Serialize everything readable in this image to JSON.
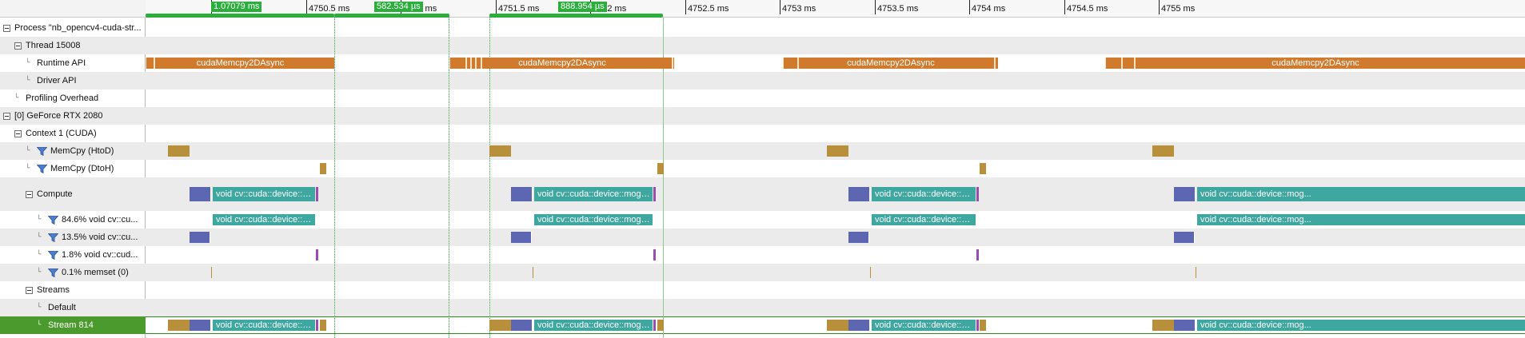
{
  "tree": {
    "rows": [
      {
        "label": "Process \"nb_opencv4-cuda-str...",
        "indent": 0,
        "toggle": true
      },
      {
        "label": "Thread 15008",
        "indent": 1,
        "toggle": true
      },
      {
        "label": "Runtime API",
        "indent": 2,
        "branch": true
      },
      {
        "label": "Driver API",
        "indent": 2,
        "branch": true
      },
      {
        "label": "Profiling Overhead",
        "indent": 1,
        "branch": true
      },
      {
        "label": "[0] GeForce RTX 2080",
        "indent": 0,
        "toggle": true
      },
      {
        "label": "Context 1 (CUDA)",
        "indent": 1,
        "toggle": true
      },
      {
        "label": "MemCpy (HtoD)",
        "indent": 2,
        "branch": true,
        "filter": true
      },
      {
        "label": "MemCpy (DtoH)",
        "indent": 2,
        "branch": true,
        "filter": true
      },
      {
        "label": "Compute",
        "indent": 2,
        "toggle": true,
        "tall": true
      },
      {
        "label": "84.6% void cv::cu...",
        "indent": 3,
        "branch": true,
        "filter": true
      },
      {
        "label": "13.5% void cv::cu...",
        "indent": 3,
        "branch": true,
        "filter": true
      },
      {
        "label": "1.8% void cv::cud...",
        "indent": 3,
        "branch": true,
        "filter": true
      },
      {
        "label": "0.1% memset (0)",
        "indent": 3,
        "branch": true,
        "filter": true
      },
      {
        "label": "Streams",
        "indent": 2,
        "toggle": true
      },
      {
        "label": "Default",
        "indent": 3,
        "branch": true
      },
      {
        "label": "Stream 814",
        "indent": 3,
        "branch": true,
        "selected": true
      }
    ]
  },
  "ruler": {
    "ticks": [
      "4750 ms",
      "4750.5 ms",
      "4751 ms",
      "4751.5 ms",
      "4752 ms",
      "4752.5 ms",
      "4753 ms",
      "4753.5 ms",
      "4754 ms",
      "4754.5 ms",
      "4755 ms"
    ],
    "ranges": [
      {
        "label": "1.07079 ms"
      },
      {
        "label": "582.534 µs"
      },
      {
        "label": "888.954 µs"
      }
    ]
  },
  "events": {
    "runtime_label": "cudaMemcpy2DAsync",
    "kernel_label": "void cv::cuda::device::mog...",
    "kernel_label_b": "void cv::cuda::device::mog2::m..."
  },
  "colors": {
    "runtime_api": "#cf7a2c",
    "memcpy": "#b88f3a",
    "kernel_getBackgroundImage": "#5d66b0",
    "kernel_mog2": "#3ea7a0",
    "kernel_small": "#9a4db0",
    "selection": "#4a9a2e",
    "range": "#2bae3c"
  }
}
